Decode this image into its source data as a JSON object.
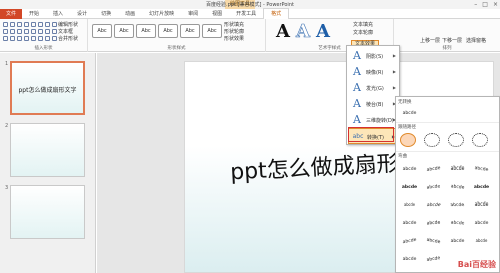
{
  "titlebar": {
    "title": "百度经验.ppt [兼容模式] - PowerPoint",
    "context_tab": "绘图工具",
    "min": "–",
    "max": "□",
    "close": "×"
  },
  "tabs": [
    "文件",
    "开始",
    "插入",
    "设计",
    "切换",
    "动画",
    "幻灯片放映",
    "审阅",
    "视图",
    "开发工具",
    "格式"
  ],
  "ribbon": {
    "insert_shapes": {
      "label": "插入形状",
      "edit_shape": "编辑形状",
      "text_box": "文本框",
      "merge_shapes": "合并形状"
    },
    "shape_styles": {
      "label": "形状样式",
      "samples": [
        "Abc",
        "Abc",
        "Abc",
        "Abc",
        "Abc",
        "Abc",
        "Abc"
      ],
      "fill": "形状填充",
      "outline": "形状轮廓",
      "effects": "形状效果"
    },
    "wordart_styles": {
      "label": "艺术字样式",
      "text_fill": "文本填充",
      "text_outline": "文本轮廓",
      "text_effects": "文本效果"
    },
    "arrange": {
      "label": "排列",
      "bring_forward": "上移一层",
      "send_backward": "下移一层",
      "selection_pane": "选择窗格"
    }
  },
  "slides": [
    {
      "number": "1",
      "text": "ppt怎么做成扇形文字"
    },
    {
      "number": "2",
      "text": ""
    },
    {
      "number": "3",
      "text": ""
    }
  ],
  "canvas": {
    "wordart_text": "ppt怎么做成扇形"
  },
  "text_effects_menu": [
    {
      "label": "阴影(S)"
    },
    {
      "label": "映像(R)"
    },
    {
      "label": "发光(G)"
    },
    {
      "label": "棱台(B)"
    },
    {
      "label": "三维旋转(D)"
    },
    {
      "label": "转换(T)"
    }
  ],
  "transform_gallery": {
    "no_transform_header": "无转换",
    "no_transform_sample": "abcde",
    "follow_path_header": "跟随路径",
    "warp_header": "弯曲",
    "warp_sample": "abcde",
    "watermark": "Bai百经验"
  },
  "colors": {
    "accent": "#c25b00",
    "file_tab": "#d24726",
    "highlight": "#fde6b8",
    "red_box": "#d63030"
  }
}
